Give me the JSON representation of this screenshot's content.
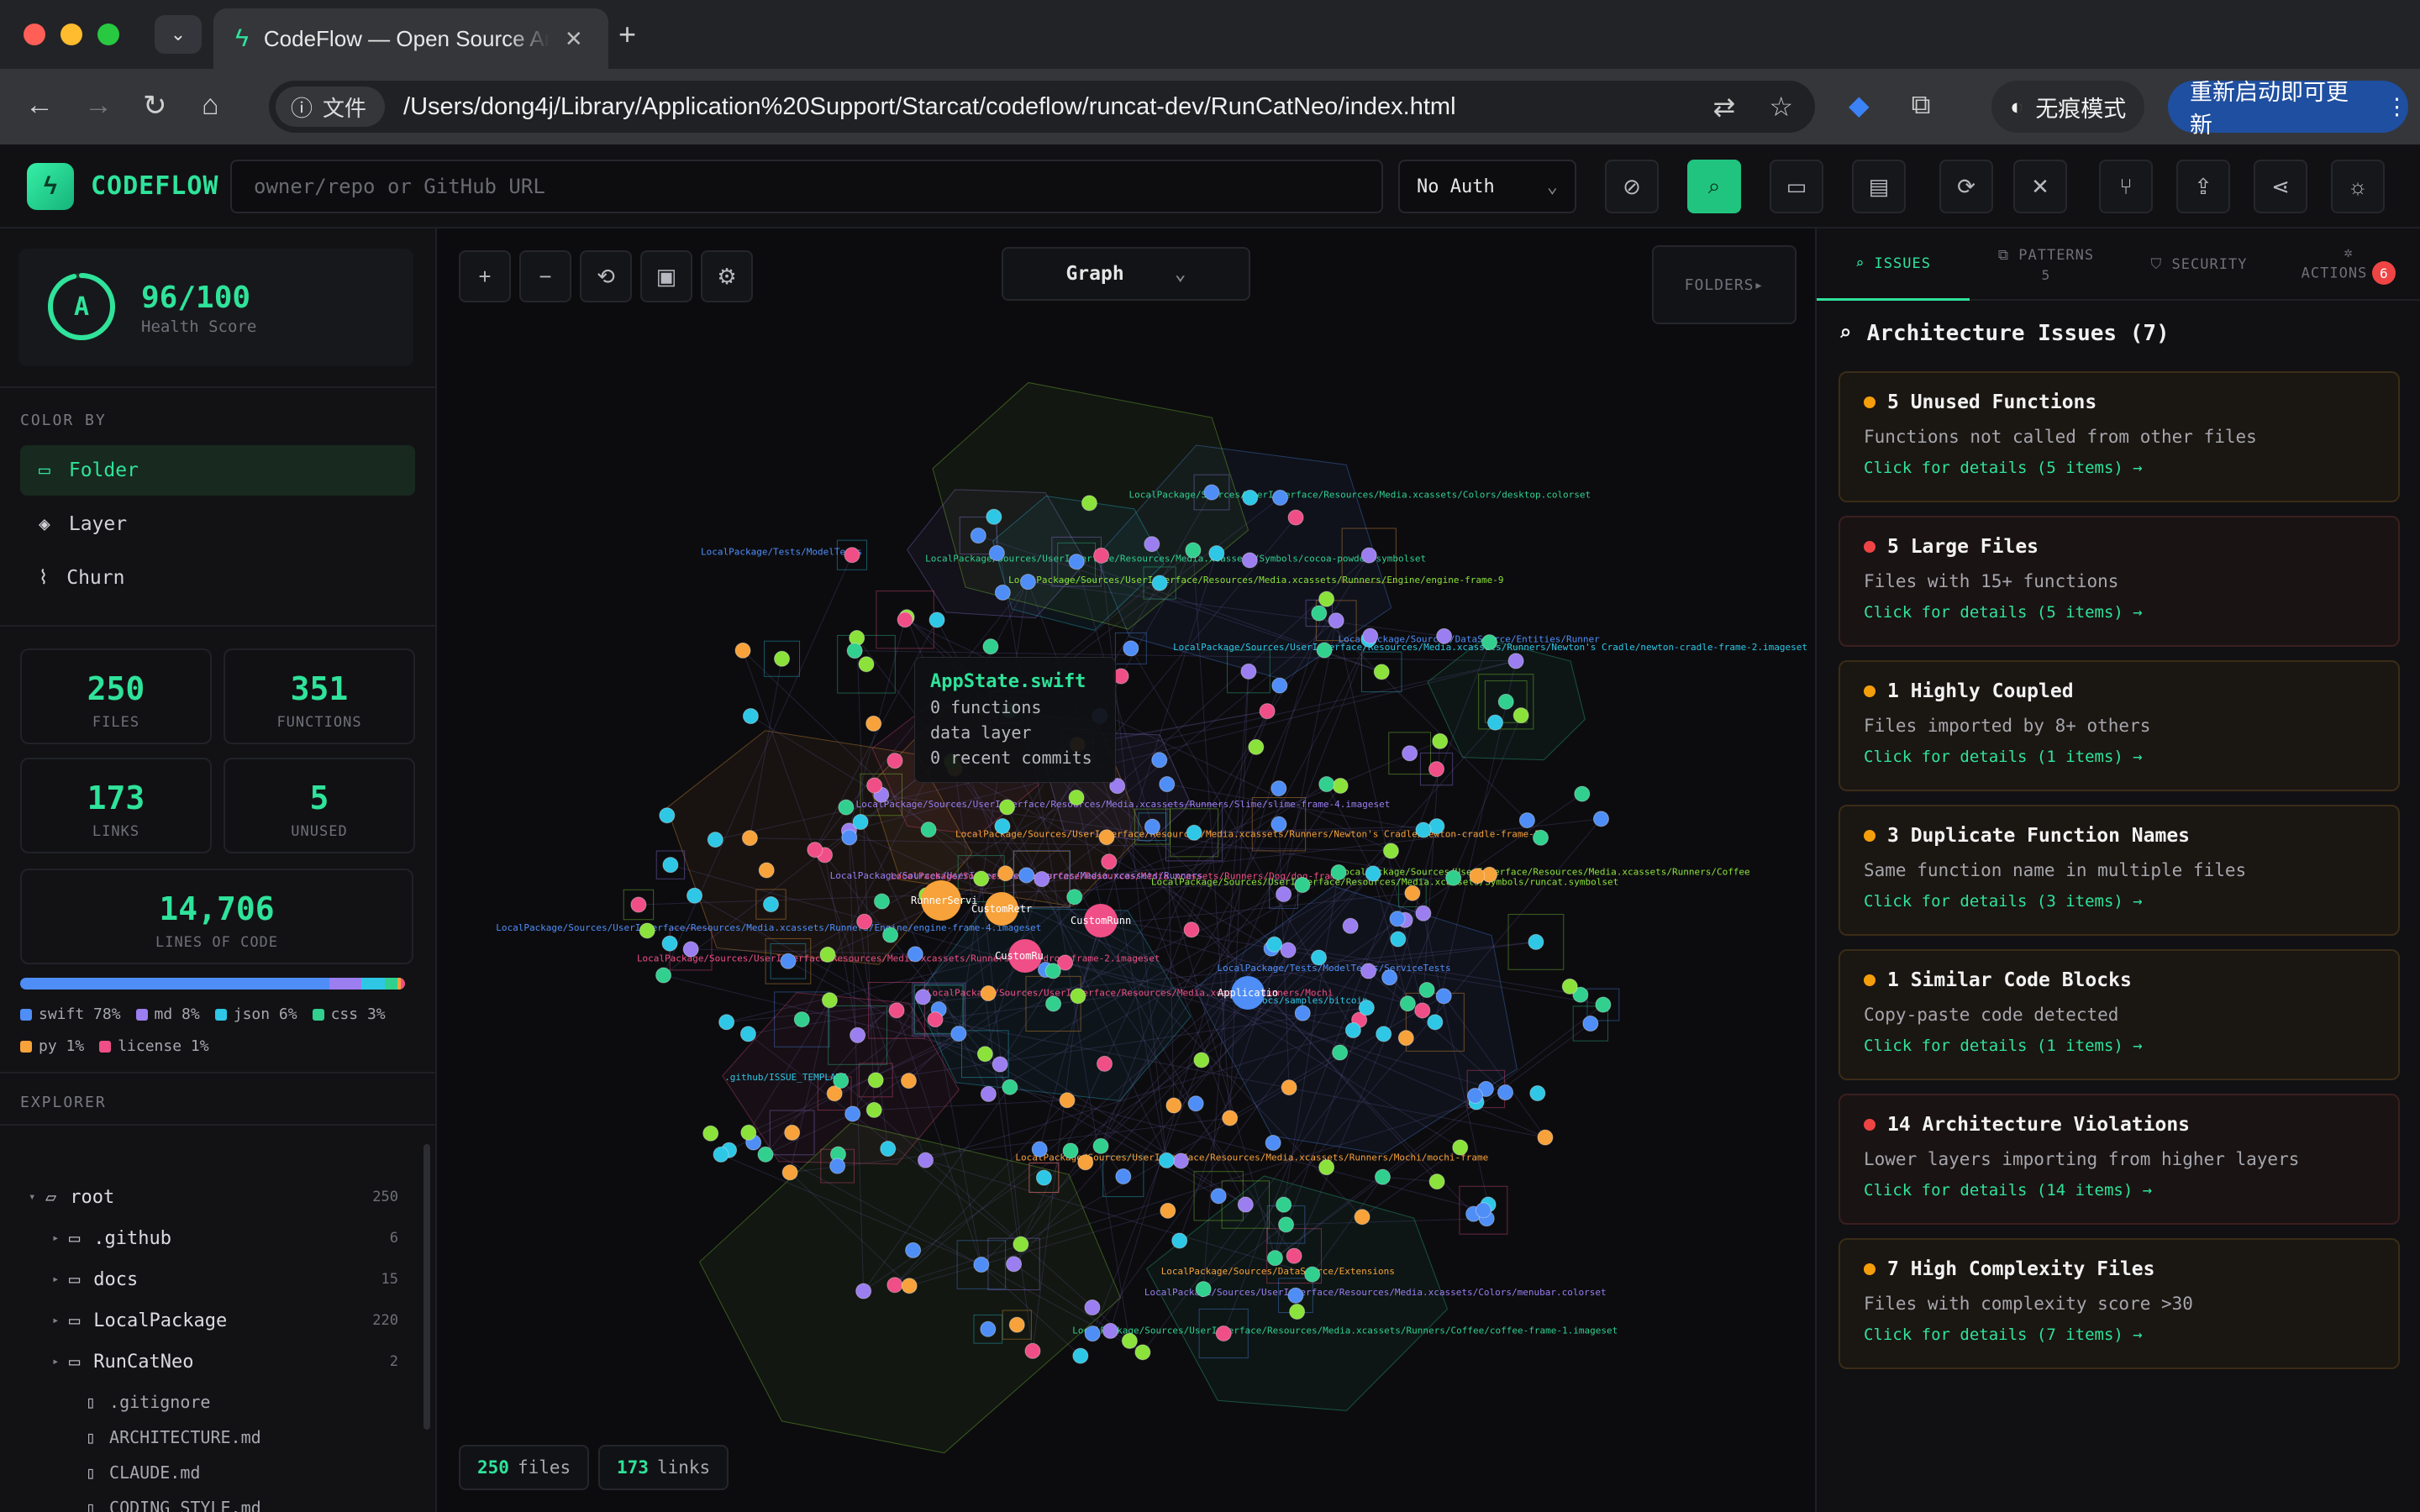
{
  "browser": {
    "tab_title": "CodeFlow — Open Source Arc",
    "address_chip": "文件",
    "url": "/Users/dong4j/Library/Application%20Support/Starcat/codeflow/runcat-dev/RunCatNeo/index.html",
    "incognito_label": "无痕模式",
    "update_label": "重新启动即可更新"
  },
  "header": {
    "logo_text": "CODEFLOW",
    "repo_placeholder": "owner/repo or GitHub URL",
    "auth_value": "No Auth"
  },
  "sidebar": {
    "health": {
      "grade": "A",
      "score": "96/100",
      "label": "Health Score",
      "fraction": 0.96
    },
    "color_by_title": "COLOR BY",
    "color_by": [
      {
        "label": "Folder",
        "icon": "folder-icon"
      },
      {
        "label": "Layer",
        "icon": "layers-icon"
      },
      {
        "label": "Churn",
        "icon": "activity-icon"
      }
    ],
    "stats": [
      {
        "value": "250",
        "label": "FILES"
      },
      {
        "value": "351",
        "label": "FUNCTIONS"
      },
      {
        "value": "173",
        "label": "LINKS"
      },
      {
        "value": "5",
        "label": "UNUSED"
      }
    ],
    "loc": {
      "value": "14,706",
      "label": "LINES OF CODE"
    },
    "languages": [
      {
        "name": "swift",
        "pct": "78%",
        "share": 78,
        "color": "#4f8ef7"
      },
      {
        "name": "md",
        "pct": "8%",
        "share": 8,
        "color": "#9b7ef0"
      },
      {
        "name": "json",
        "pct": "6%",
        "share": 6,
        "color": "#2ec7e6"
      },
      {
        "name": "css",
        "pct": "3%",
        "share": 3,
        "color": "#31d08f"
      },
      {
        "name": "py",
        "pct": "1%",
        "share": 1,
        "color": "#f7a23a"
      },
      {
        "name": "license",
        "pct": "1%",
        "share": 1,
        "color": "#ef4f86"
      }
    ],
    "explorer_title": "EXPLORER",
    "tree": {
      "root": {
        "name": "root",
        "count": "250"
      },
      "folders": [
        {
          "name": ".github",
          "count": "6"
        },
        {
          "name": "docs",
          "count": "15"
        },
        {
          "name": "LocalPackage",
          "count": "220"
        },
        {
          "name": "RunCatNeo",
          "count": "2"
        }
      ],
      "files": [
        ".gitignore",
        "ARCHITECTURE.md",
        "CLAUDE.md",
        "CODING_STYLE.md"
      ]
    }
  },
  "canvas": {
    "view_mode": "Graph",
    "folders_label": "FOLDERS▸",
    "tooltip": {
      "title": "AppState.swift",
      "lines": [
        "0 functions",
        "data layer",
        "0 recent commits"
      ]
    },
    "status": {
      "files_value": "250",
      "files_label": "files",
      "links_value": "173",
      "links_label": "links"
    },
    "node_labels": [
      "LocalPackage/Sources/DataSource/Entities/Runner",
      "LocalPackage/Sources/UserInterface/Resources/Media.xcassets/Colors/menubar.colorset",
      ".github/ISSUE_TEMPLATE",
      "LocalPackage/Sources/UserInterface/Resources/Media.xcassets/Runners/Coffee/coffee-frame-1.imageset",
      "LocalPackage/Sources/DataSource/Extensions",
      "LocalPackage/Sources/UserInterface/Resources/Media.xcassets/Runners/Dog/dog-frame",
      "LocalPackage/Sources/UserInterface/Resources/Media.xcassets/Runners/Coffee",
      "LocalPackage/Sources/UserInterface/Resources/Media.xcassets/Runners/Engine/engine-frame-4.imageset",
      "LocalPackage/Sources/UserInterface/Resources/Media.xcassets/Runners/Slime/slime-frame-4.imageset",
      "LocalPackage/Sources/UserInterface/Resources/Media.xcassets/Runners/Newton's Cradle/newton-cradle-frame-2.imageset",
      "LocalPackage/Sources/UserInterface/Resources/Media.xcassets/Colors/desktop.colorset",
      "LocalPackage/Sources/UserInterface/Resources/Media.xcassets/Runners/Mochi/mochi-frame",
      "LocalPackage/Sources/UserInterface/Resources/Media.xcassets/Runners/Drop/drop-frame-2.imageset",
      "LocalPackage/Sources/UserInterface/Resources/Media.xcassets/Runners/Engine/engine-frame-9",
      "LocalPackage/Tests/ModelTests/ServiceTests",
      "LocalPackage/Sources/UserInterface/Resources/Media.xcassets/Runners",
      "docs/samples/bitcoin",
      "LocalPackage/Sources/UserInterface/Resources/Media.xcassets/Symbols/cocoa-powder.symbolset",
      "LocalPackage/Sources/UserInterface/Resources/Media.xcassets/Runners/Newton's Cradle/newton-cradle-frame-1",
      "LocalPackage/Sources/UserInterface/Resources/Media.xcassets/Runners/Mochi",
      "LocalPackage/Sources/UserInterface/Resources/Media.xcassets/Symbols/runcat.symbolset",
      "LocalPackage/Tests/ModelTests"
    ],
    "big_node_labels": [
      "RunnerServi",
      "CustomRetr",
      "CustomRunn",
      "CustomRu",
      "Applicatio"
    ]
  },
  "right_panel": {
    "tabs": [
      {
        "label": "ISSUES",
        "sub": ""
      },
      {
        "label": "PATTERNS",
        "sub": "5"
      },
      {
        "label": "SECURITY",
        "sub": ""
      },
      {
        "label": "ACTIONS",
        "badge": "6"
      }
    ],
    "issues_title": "Architecture Issues (7)",
    "issues": [
      {
        "title": "5 Unused Functions",
        "desc": "Functions not called from other files",
        "link": "Click for details (5 items) →",
        "severity": "orange"
      },
      {
        "title": "5 Large Files",
        "desc": "Files with 15+ functions",
        "link": "Click for details (5 items) →",
        "severity": "red"
      },
      {
        "title": "1 Highly Coupled",
        "desc": "Files imported by 8+ others",
        "link": "Click for details (1 items) →",
        "severity": "orange"
      },
      {
        "title": "3 Duplicate Function Names",
        "desc": "Same function name in multiple files",
        "link": "Click for details (3 items) →",
        "severity": "orange"
      },
      {
        "title": "1 Similar Code Blocks",
        "desc": "Copy-paste code detected",
        "link": "Click for details (1 items) →",
        "severity": "orange"
      },
      {
        "title": "14 Architecture Violations",
        "desc": "Lower layers importing from higher layers",
        "link": "Click for details (14 items) →",
        "severity": "red"
      },
      {
        "title": "7 High Complexity Files",
        "desc": "Files with complexity score >30",
        "link": "Click for details (7 items) →",
        "severity": "orange"
      }
    ]
  },
  "colors": {
    "accent": "#2fe39a",
    "orange": "#f59e0b",
    "red": "#ef4444",
    "node_palette": [
      "#4f8ef7",
      "#9b7ef0",
      "#2ec7e6",
      "#31d08f",
      "#f7a23a",
      "#ef4f86",
      "#8be23a"
    ]
  }
}
